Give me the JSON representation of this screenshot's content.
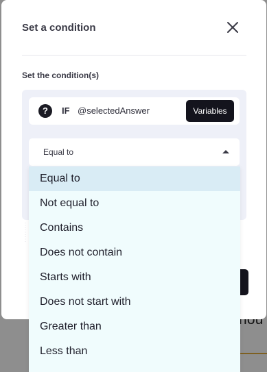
{
  "background": {
    "partial_text": "hou"
  },
  "modal": {
    "title": "Set a condition",
    "close_icon": "close-icon",
    "section_label": "Set the condition(s)",
    "if_row": {
      "help_icon": "question-icon",
      "help_glyph": "?",
      "if_label": "IF",
      "variable": "@selectedAnswer",
      "variables_button": "Variables"
    },
    "operator_select": {
      "value": "Equal to",
      "caret_icon": "caret-up-icon"
    }
  },
  "dropdown": {
    "options": [
      "Equal to",
      "Not equal to",
      "Contains",
      "Does not contain",
      "Starts with",
      "Does not start with",
      "Greater than",
      "Less than"
    ],
    "selected": "Equal to"
  },
  "colors": {
    "overlay": "#000000",
    "dark_button": "#14141d",
    "panel_bg": "#eef0f8",
    "dropdown_bg": "#f0fcfd",
    "dropdown_highlight": "#d9ecf5"
  }
}
